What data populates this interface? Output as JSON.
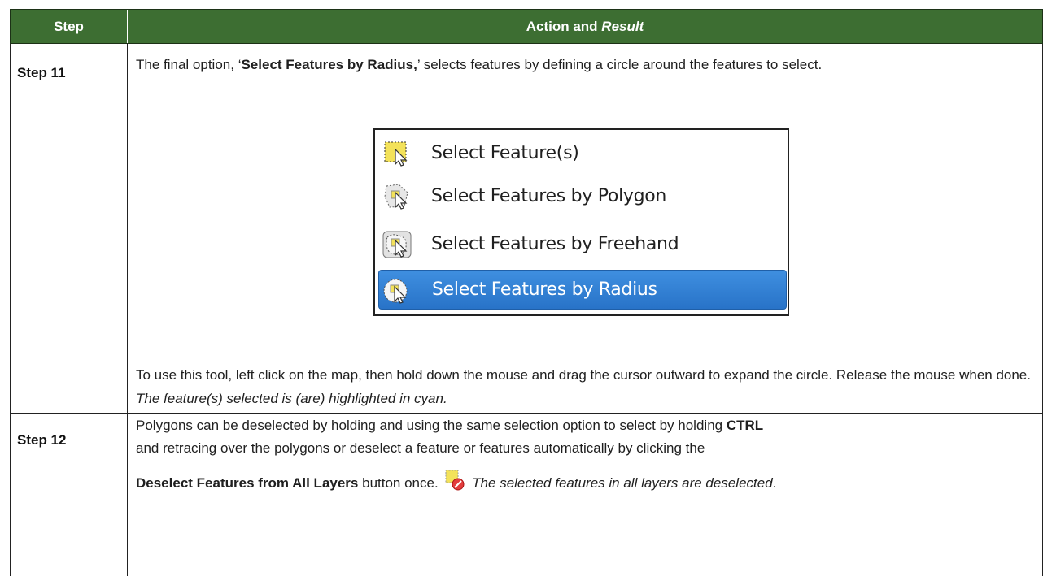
{
  "header": {
    "step": "Step",
    "action_prefix": "Action and ",
    "action_italic": "Result"
  },
  "row1": {
    "step": "Step 11",
    "para1_pre": "The final option, ‘",
    "para1_bold": "Select Features by Radius,",
    "para1_post": "’ selects features by defining a circle around the features to select.",
    "para2": "To use this tool, left click on the map, then hold down the mouse and drag the cursor outward to expand the circle. Release the mouse when done. ",
    "para2_italic": "The feature(s) selected is (are) highlighted in cyan."
  },
  "menu": {
    "items": [
      {
        "label": "Select Feature(s)",
        "icon": "select-feature-icon",
        "active": false
      },
      {
        "label": "Select Features by Polygon",
        "icon": "select-polygon-icon",
        "active": false
      },
      {
        "label": "Select Features by Freehand",
        "icon": "select-freehand-icon",
        "active": false
      },
      {
        "label": "Select Features by Radius",
        "icon": "select-radius-icon",
        "active": true
      }
    ],
    "active_color": "#2f7fd6"
  },
  "row2": {
    "step": "Step 12",
    "line1_pre": "Polygons can be deselected by holding and using the same selection option to select by holding ",
    "line1_bold": "CTRL",
    "line2": "and retracing over the polygons or deselect a feature or features automatically by clicking the",
    "line3_bold": "Deselect Features from All Layers",
    "line3_mid": " button once.",
    "line3_italic": "The selected features in all layers are deselected",
    "line3_end": "."
  },
  "colors": {
    "header_bg": "#3d6e32",
    "header_text": "#ffffff"
  }
}
